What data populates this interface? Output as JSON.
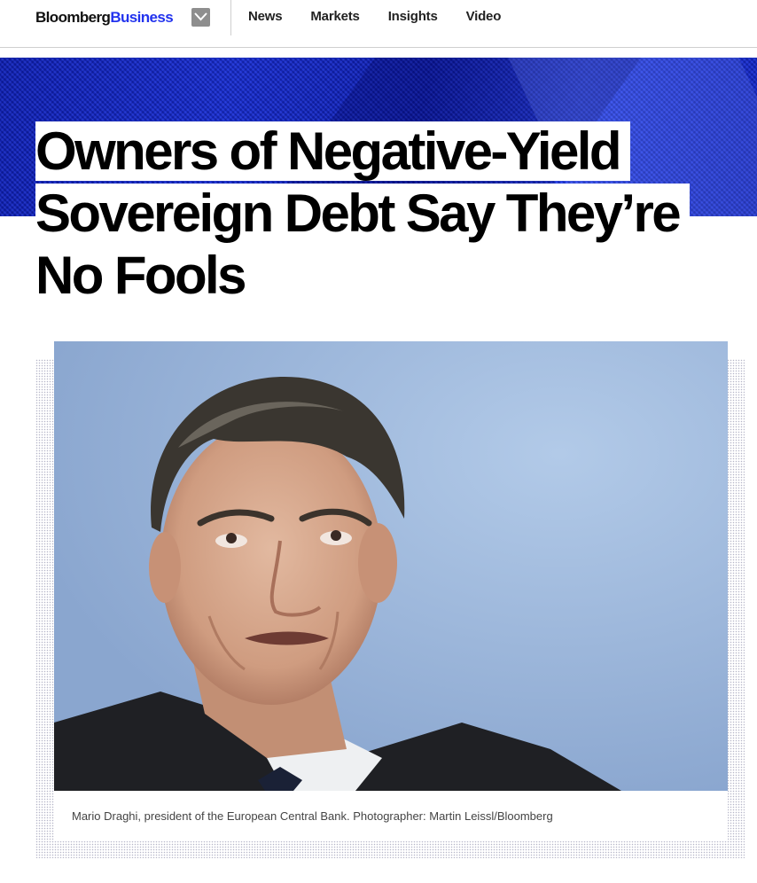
{
  "header": {
    "logo_part1": "Bloomberg",
    "logo_part2": "Business",
    "menu_icon": "chevron-down-icon",
    "nav": [
      {
        "label": "News"
      },
      {
        "label": "Markets"
      },
      {
        "label": "Insights"
      },
      {
        "label": "Video"
      }
    ]
  },
  "article": {
    "headline_lines": [
      "Owners of Negative-Yield",
      "Sovereign Debt Say They’re",
      "No Fools"
    ],
    "caption": "Mario Draghi, president of the European Central Bank. Photographer: Martin Leissl/Bloomberg"
  },
  "colors": {
    "brand_blue": "#2233ee",
    "hero_blue": "#1428c8",
    "photo_background": "#9cb8dc"
  }
}
